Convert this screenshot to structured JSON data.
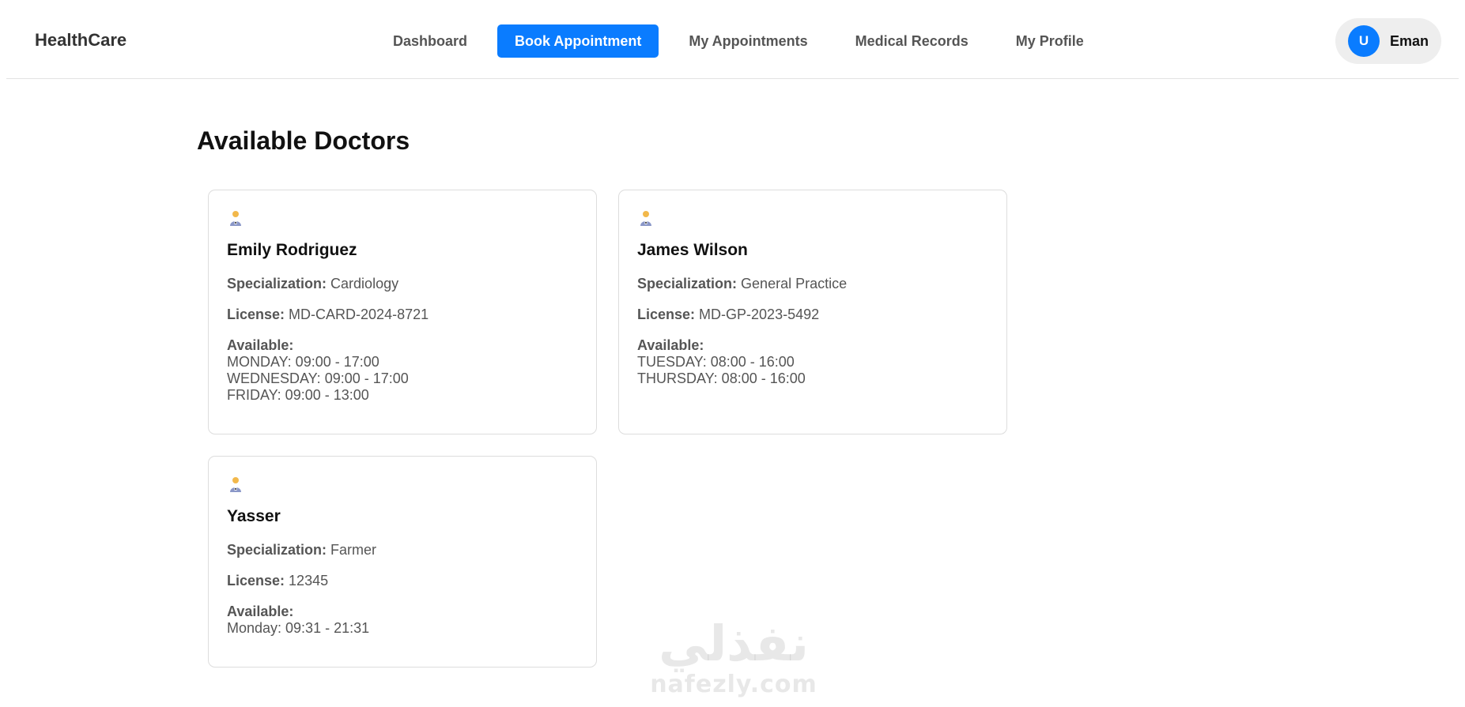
{
  "header": {
    "brand": "HealthCare",
    "nav": [
      {
        "label": "Dashboard",
        "active": false
      },
      {
        "label": "Book Appointment",
        "active": true
      },
      {
        "label": "My Appointments",
        "active": false
      },
      {
        "label": "Medical Records",
        "active": false
      },
      {
        "label": "My Profile",
        "active": false
      }
    ],
    "user": {
      "initial": "U",
      "name": "Eman"
    }
  },
  "colors": {
    "accent": "#0a7cff",
    "text_muted": "#555555"
  },
  "main": {
    "title": "Available Doctors",
    "doctors": [
      {
        "icon": "doctor-icon",
        "name": "Emily Rodriguez",
        "specialization_label": "Specialization:",
        "specialization": "Cardiology",
        "license_label": "License:",
        "license": "MD-CARD-2024-8721",
        "available_label": "Available:",
        "slots": [
          "MONDAY: 09:00 - 17:00",
          "WEDNESDAY: 09:00 - 17:00",
          "FRIDAY: 09:00 - 13:00"
        ]
      },
      {
        "icon": "doctor-icon",
        "name": "James Wilson",
        "specialization_label": "Specialization:",
        "specialization": "General Practice",
        "license_label": "License:",
        "license": "MD-GP-2023-5492",
        "available_label": "Available:",
        "slots": [
          "TUESDAY: 08:00 - 16:00",
          "THURSDAY: 08:00 - 16:00"
        ]
      },
      {
        "icon": "doctor-icon",
        "name": "Yasser",
        "specialization_label": "Specialization:",
        "specialization": "Farmer",
        "license_label": "License:",
        "license": "12345",
        "available_label": "Available:",
        "slots": [
          "Monday: 09:31 - 21:31"
        ]
      }
    ]
  },
  "watermark": {
    "arabic": "نفذلي",
    "latin": "nafezly.com"
  }
}
